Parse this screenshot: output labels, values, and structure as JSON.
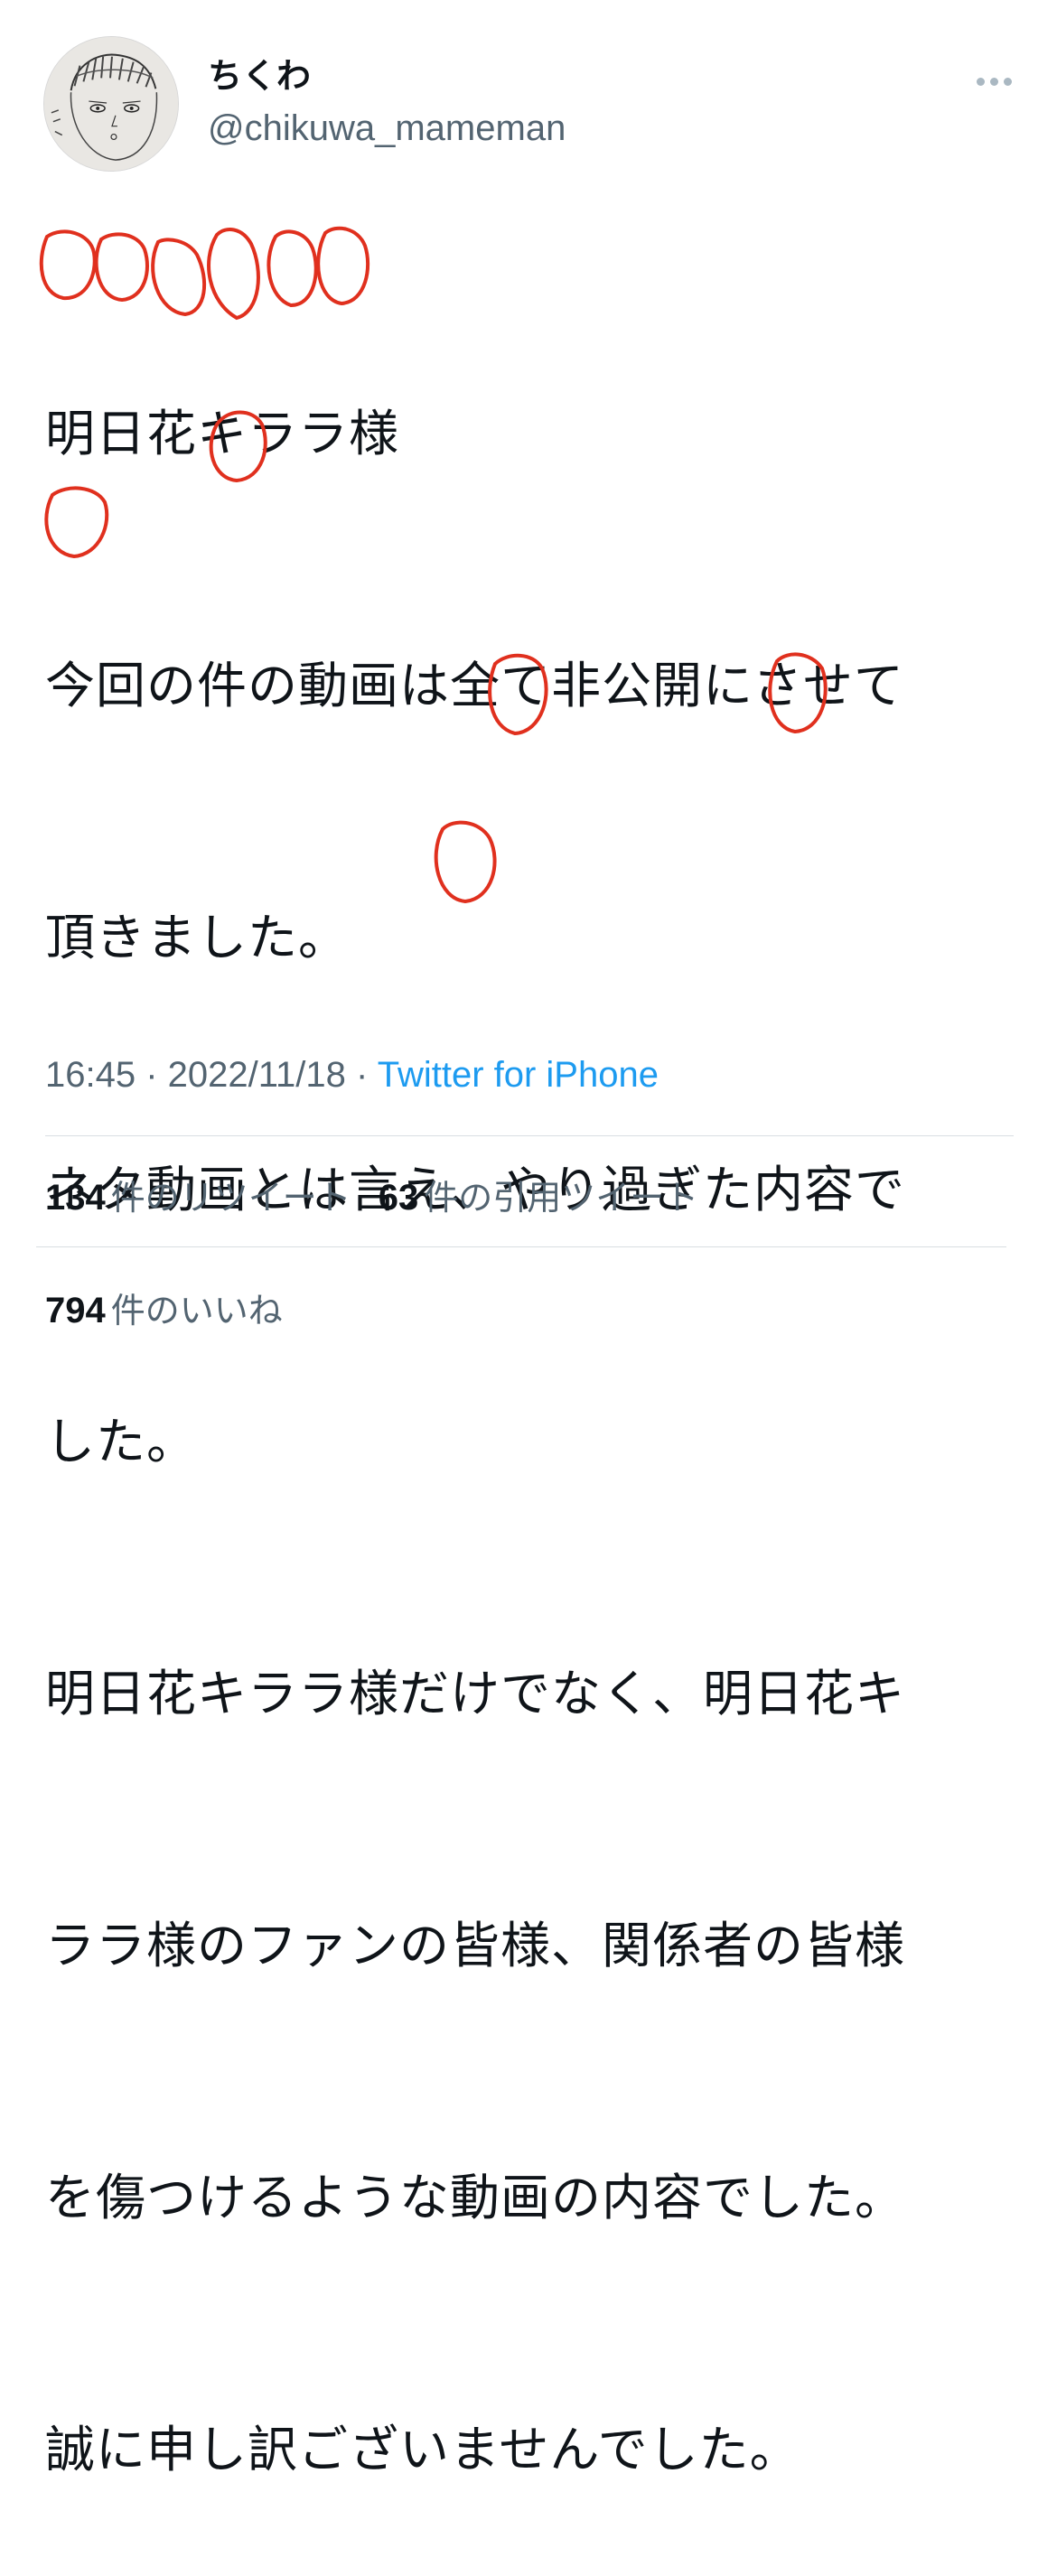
{
  "tweet": {
    "author": {
      "display_name": "ちくわ",
      "handle": "@chikuwa_mameman",
      "avatar_icon": "hand-drawn-face-avatar"
    },
    "more_icon": "ellipsis-icon",
    "text_lines": [
      "明日花キララ様",
      "今回の件の動画は全て非公開にさせて",
      "頂きました。",
      "ネタ動画とは言え、やり過ぎた内容で",
      "した。",
      "明日花キララ様だけでなく、明日花キ",
      "ララ様のファンの皆様、関係者の皆様",
      "を傷つけるような動画の内容でした。",
      "誠に申し訳ございませんでした。"
    ],
    "time": "16:45",
    "separator": " · ",
    "date": "2022/11/18",
    "source": "Twitter for iPhone",
    "retweets": {
      "count": "134",
      "label": "件のリツイート"
    },
    "quotes": {
      "count": "63",
      "label": "件の引用ツイート"
    },
    "likes": {
      "count": "794",
      "label": "件のいいね"
    },
    "colors": {
      "text": "#0f1419",
      "secondary": "#536471",
      "link": "#1d9bf0",
      "annotation": "#e0301e"
    }
  }
}
